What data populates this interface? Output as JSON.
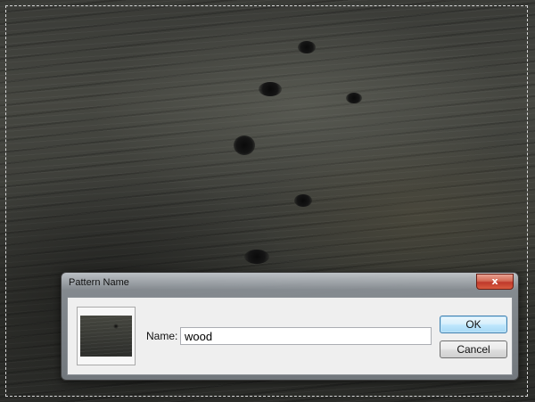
{
  "dialog": {
    "title": "Pattern Name",
    "close_glyph": "x",
    "name_label": "Name:",
    "name_value": "wood",
    "ok_label": "OK",
    "cancel_label": "Cancel"
  },
  "icons": {
    "close": "close-icon",
    "preview": "pattern-preview-thumbnail"
  },
  "colors": {
    "close_button": "#c0392b",
    "default_button_border": "#3c7fb1",
    "selection_marquee": "#d8d8d8"
  }
}
